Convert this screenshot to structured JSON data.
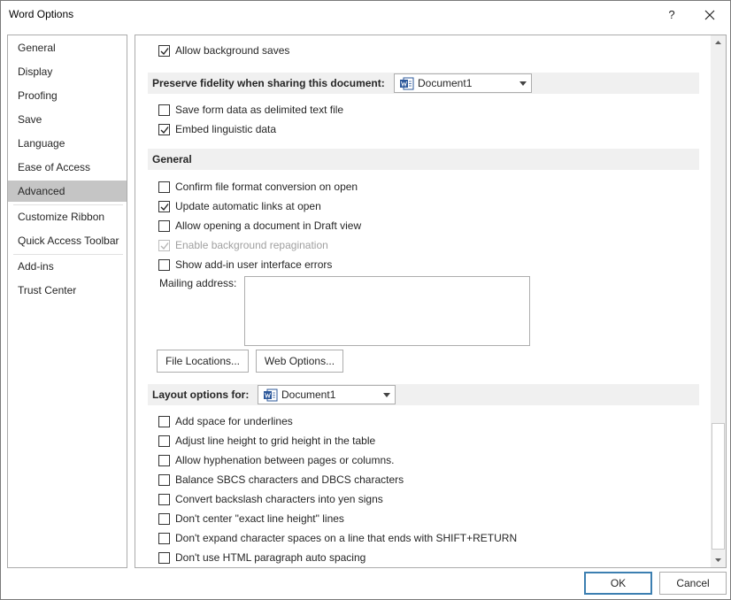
{
  "window": {
    "title": "Word Options",
    "help": "?",
    "close_icon": "close-icon"
  },
  "nav": {
    "items": [
      {
        "label": "General"
      },
      {
        "label": "Display"
      },
      {
        "label": "Proofing"
      },
      {
        "label": "Save"
      },
      {
        "label": "Language"
      },
      {
        "label": "Ease of Access"
      },
      {
        "label": "Advanced",
        "active": true
      },
      {
        "label": "Customize Ribbon"
      },
      {
        "label": "Quick Access Toolbar"
      },
      {
        "label": "Add-ins"
      },
      {
        "label": "Trust Center"
      }
    ]
  },
  "content": {
    "top_options": [
      {
        "label": "Allow background saves",
        "checked": true
      }
    ],
    "preserve": {
      "heading": "Preserve fidelity when sharing this document:",
      "document": "Document1",
      "options": [
        {
          "label": "Save form data as delimited text file",
          "checked": false
        },
        {
          "label": "Embed linguistic data",
          "checked": true
        }
      ]
    },
    "general": {
      "heading": "General",
      "options": [
        {
          "label": "Confirm file format conversion on open",
          "checked": false
        },
        {
          "label": "Update automatic links at open",
          "checked": true
        },
        {
          "label": "Allow opening a document in Draft view",
          "checked": false
        },
        {
          "label": "Enable background repagination",
          "checked": true,
          "disabled": true
        },
        {
          "label": "Show add-in user interface errors",
          "checked": false
        }
      ],
      "mailing_label": "Mailing address:",
      "mailing_value": "",
      "file_locations_button": "File Locations...",
      "web_options_button": "Web Options..."
    },
    "layout": {
      "heading": "Layout options for:",
      "document": "Document1",
      "options": [
        {
          "label": "Add space for underlines",
          "checked": false
        },
        {
          "label": "Adjust line height to grid height in the table",
          "checked": false
        },
        {
          "label": "Allow hyphenation between pages or columns.",
          "checked": false
        },
        {
          "label": "Balance SBCS characters and DBCS characters",
          "checked": false
        },
        {
          "label": "Convert backslash characters into yen signs",
          "checked": false
        },
        {
          "label": "Don't center \"exact line height\" lines",
          "checked": false
        },
        {
          "label": "Don't expand character spaces on a line that ends with SHIFT+RETURN",
          "checked": false
        },
        {
          "label": "Don't use HTML paragraph auto spacing",
          "checked": false
        }
      ]
    }
  },
  "footer": {
    "ok": "OK",
    "cancel": "Cancel"
  },
  "colors": {
    "accent": "#3c7fb1",
    "nav_active": "#c5c5c5",
    "section_bg": "#f0f0f0",
    "word_blue": "#2b579a"
  }
}
